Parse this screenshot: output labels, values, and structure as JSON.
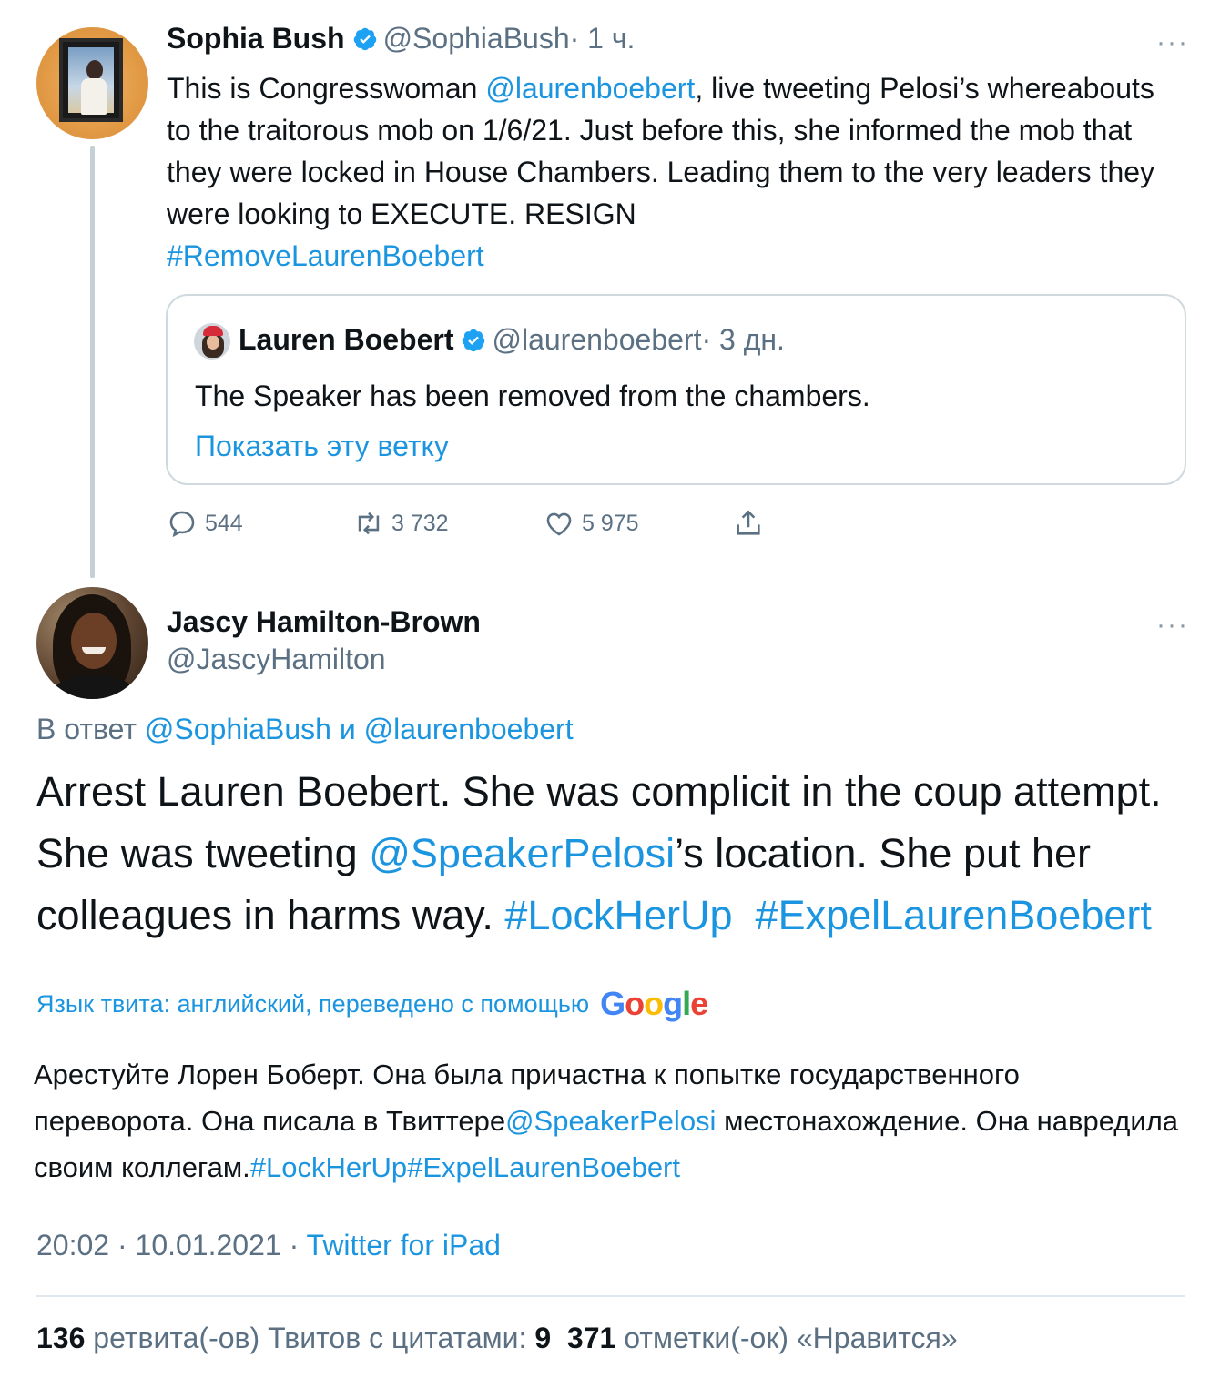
{
  "tweet1": {
    "author_name": "Sophia Bush",
    "author_handle": "@SophiaBush",
    "time": "· 1 ч.",
    "text_1": "This is Congresswoman ",
    "mention": "@laurenboebert",
    "text_2": ", live tweeting Pelosi’s whereabouts to the traitorous mob on 1/6/21. Just before this, she informed the mob that they were locked in House Chambers. Leading them to the very leaders they were looking to EXECUTE. RESIGN",
    "hashtag": "#RemoveLaurenBoebert",
    "quote": {
      "author_name": "Lauren Boebert",
      "author_handle": "@laurenboebert",
      "time": "· 3 дн.",
      "text": "The Speaker has been removed from the chambers.",
      "show_thread": "Показать эту ветку"
    },
    "actions": {
      "replies": "544",
      "retweets": "3 732",
      "likes": "5 975"
    },
    "more": "···"
  },
  "tweet2": {
    "author_name": "Jascy Hamilton-Brown",
    "author_handle": "@JascyHamilton",
    "more": "···",
    "reply_prefix": "В ответ ",
    "reply_user1": "@SophiaBush",
    "reply_and": " и ",
    "reply_user2": "@laurenboebert",
    "text_1": "Arrest Lauren Boebert.  She was complicit in the coup attempt.  She was tweeting ",
    "mention": "@SpeakerPelosi",
    "text_2": "’s location.  She put her colleagues in harms way.  ",
    "hashtag1": "#LockHerUp",
    "hashtag2": "#ExpelLaurenBoebert",
    "translation_label": "Язык твита: английский, переведено с помощью",
    "google": [
      "G",
      "o",
      "o",
      "g",
      "l",
      "e"
    ],
    "translated_1": "Арестуйте Лорен Боберт. Она была причастна к попытке государственного переворота. Она писала в Твиттере",
    "translated_mention": "@SpeakerPelosi",
    "translated_2": " местонахождение. Она навредила своим коллегам.",
    "translated_tag1": "#LockHerUp",
    "translated_tag2": "#ExpelLaurenBoebert",
    "timestamp": "20:02 · 10.01.2021 · ",
    "client": "Twitter for iPad",
    "stats": {
      "retweets_count": "136",
      "retweets_label": " ретвита(-ов)  ",
      "quotes_label": "Твитов с цитатами: ",
      "quotes_count": "9",
      "likes_count": "371",
      "likes_label": " отметки(-ок) «Нравится»"
    }
  },
  "colors": {
    "link": "#1b95e0",
    "secondary": "#5b7083",
    "text": "#0f1419",
    "verified": "#1da1f2"
  },
  "icons": [
    "verified-badge-icon",
    "reply-icon",
    "retweet-icon",
    "like-icon",
    "share-icon",
    "more-icon"
  ]
}
